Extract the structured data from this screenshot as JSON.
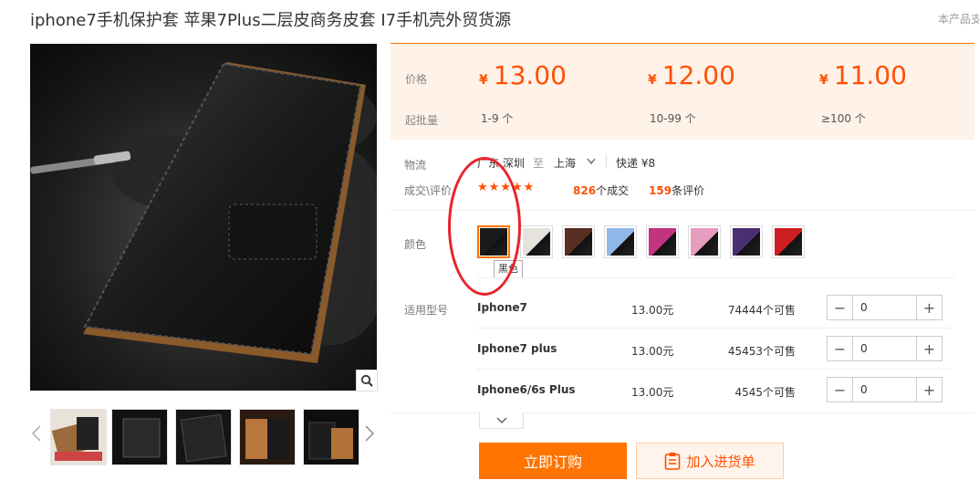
{
  "title": "iphone7手机保护套 苹果7Plus二层皮商务皮套 I7手机壳外贸货源",
  "side_note": "本产品支",
  "icons": {
    "zoom": "magnifier-icon",
    "thumbs_prev": "chevron-left-icon",
    "thumbs_next": "chevron-right-icon",
    "shipping_dropdown": "chevron-down-icon",
    "expand": "chevron-down-icon",
    "cart": "clipboard-icon"
  },
  "colors": {
    "accent": "#ff7300",
    "price": "#ff5000",
    "price_bg": "#fff2e8",
    "annotation": "#e8232b"
  },
  "pricing": {
    "price_label": "价格",
    "moq_label": "起批量",
    "currency": "¥",
    "tiers": [
      {
        "price": "13.00",
        "qty": "1-9 个"
      },
      {
        "price": "12.00",
        "qty": "10-99 个"
      },
      {
        "price": "11.00",
        "qty": "≥100 个"
      }
    ]
  },
  "logistics": {
    "label": "物流",
    "origin": "广东 深圳",
    "to": "至",
    "destination": "上海",
    "express": "快递 ¥8"
  },
  "reviews": {
    "label": "成交\\评价",
    "stars": "★★★★★",
    "deals_count": "826",
    "deals_suffix": "个成交",
    "reviews_count": "159",
    "reviews_suffix": "条评价"
  },
  "color_option": {
    "label": "颜色",
    "selected_tooltip": "黑色",
    "swatches": [
      {
        "name": "black",
        "color": "#1a1a1a",
        "selected": true
      },
      {
        "name": "white",
        "color": "#e6e3dc"
      },
      {
        "name": "brown",
        "color": "#5a2e22"
      },
      {
        "name": "light-blue",
        "color": "#8fb8e8"
      },
      {
        "name": "rose",
        "color": "#c3337f"
      },
      {
        "name": "pink",
        "color": "#e59cbf"
      },
      {
        "name": "purple",
        "color": "#4b2f73"
      },
      {
        "name": "red",
        "color": "#cf1e22"
      }
    ]
  },
  "models": {
    "label": "适用型号",
    "rows": [
      {
        "name": "Iphone7",
        "price": "13.00元",
        "stock": "74444个可售",
        "qty": "0"
      },
      {
        "name": "Iphone7 plus",
        "price": "13.00元",
        "stock": "45453个可售",
        "qty": "0"
      },
      {
        "name": "Iphone6/6s Plus",
        "price": "13.00元",
        "stock": "4545个可售",
        "qty": "0"
      }
    ],
    "minus": "−",
    "plus": "+"
  },
  "actions": {
    "order": "立即订购",
    "cart": "加入进货单"
  }
}
